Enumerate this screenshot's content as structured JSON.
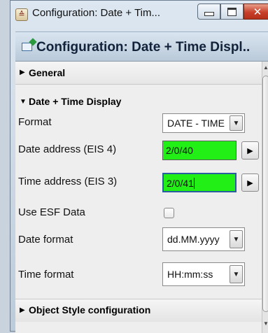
{
  "window": {
    "title": "Configuration: Date + Tim...",
    "close_glyph": "✕"
  },
  "header": {
    "title": "Configuration: Date + Time Displ.."
  },
  "sections": {
    "general": "General",
    "date_time": "Date + Time Display",
    "object_style": "Object Style configuration"
  },
  "fields": {
    "format": {
      "label": "Format",
      "value": "DATE - TIME"
    },
    "date_address": {
      "label": "Date address (EIS 4)",
      "value": "2/0/40"
    },
    "time_address": {
      "label": "Time address (EIS 3)",
      "value": "2/0/41"
    },
    "use_esf": {
      "label": "Use ESF Data",
      "checked": false
    },
    "date_format": {
      "label": "Date format",
      "value": "dd.MM.yyyy"
    },
    "time_format": {
      "label": "Time format",
      "value": "HH:mm:ss"
    }
  },
  "colors": {
    "address_field_bg": "#22ef16",
    "close_button": "#c8402a"
  },
  "icons": [
    "app-icon",
    "config-edit-icon",
    "expand-arrow-icon",
    "dropdown-arrow-icon",
    "play-arrow-icon"
  ]
}
